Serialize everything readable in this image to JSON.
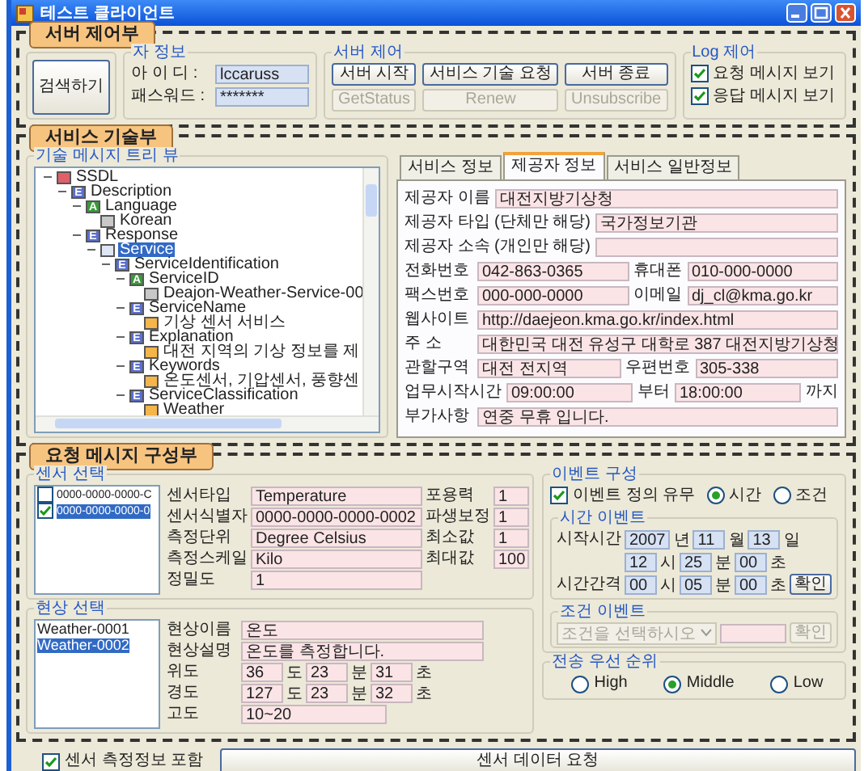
{
  "window": {
    "title": "테스트 클라이언트"
  },
  "server_control": {
    "badge": "서버 제어부",
    "search_button": "검색하기",
    "user_group": {
      "title": "자 정보",
      "fields": [
        {
          "label": "아 이 디 :",
          "value": "lccaruss"
        },
        {
          "label": "패스워드 :",
          "value": "*******"
        }
      ]
    },
    "server_group": {
      "title": "서버 제어",
      "buttons": [
        {
          "label": "서버 시작",
          "disabled": false
        },
        {
          "label": "서비스 기술 요청",
          "disabled": false
        },
        {
          "label": "서버 종료",
          "disabled": false
        },
        {
          "label": "GetStatus",
          "disabled": true
        },
        {
          "label": "Renew",
          "disabled": true
        },
        {
          "label": "Unsubscribe",
          "disabled": true
        }
      ]
    },
    "log_group": {
      "title": "Log 제어",
      "options": [
        {
          "label": "요청 메시지 보기",
          "checked": true
        },
        {
          "label": "응답 메시지 보기",
          "checked": true
        }
      ]
    }
  },
  "service_description": {
    "badge": "서비스 기술부",
    "tree": {
      "title": "기술 메시지 트리 뷰",
      "items": [
        {
          "label": "SSDL",
          "kind": "root",
          "selected": false,
          "expanded": true,
          "children": [
            {
              "label": "Description",
              "kind": "element",
              "tag": "E",
              "selected": false,
              "expanded": true,
              "children": [
                {
                  "label": "Language",
                  "kind": "attribute",
                  "tag": "A",
                  "selected": false,
                  "expanded": true,
                  "children": [
                    {
                      "label": "Korean",
                      "kind": "text",
                      "selected": false
                    }
                  ]
                },
                {
                  "label": "Response",
                  "kind": "element",
                  "tag": "E",
                  "selected": false,
                  "expanded": true,
                  "children": [
                    {
                      "label": "Service",
                      "kind": "pointer",
                      "selected": true,
                      "expanded": true,
                      "children": [
                        {
                          "label": "ServiceIdentification",
                          "kind": "element",
                          "tag": "E",
                          "selected": false,
                          "expanded": true,
                          "children": [
                            {
                              "label": "ServiceID",
                              "kind": "attribute",
                              "tag": "A",
                              "selected": false,
                              "expanded": true,
                              "children": [
                                {
                                  "label": "Deajon-Weather-Service-00",
                                  "kind": "text",
                                  "selected": false
                                }
                              ]
                            },
                            {
                              "label": "ServiceName",
                              "kind": "element",
                              "tag": "E",
                              "selected": false,
                              "expanded": true,
                              "children": [
                                {
                                  "label": "기상 센서 서비스",
                                  "kind": "value",
                                  "selected": false
                                }
                              ]
                            },
                            {
                              "label": "Explanation",
                              "kind": "element",
                              "tag": "E",
                              "selected": false,
                              "expanded": true,
                              "children": [
                                {
                                  "label": "대전 지역의 기상 정보를 제",
                                  "kind": "value",
                                  "selected": false
                                }
                              ]
                            },
                            {
                              "label": "Keywords",
                              "kind": "element",
                              "tag": "E",
                              "selected": false,
                              "expanded": true,
                              "children": [
                                {
                                  "label": "온도센서, 기압센서, 풍향센",
                                  "kind": "value",
                                  "selected": false
                                }
                              ]
                            },
                            {
                              "label": "ServiceClassification",
                              "kind": "element",
                              "tag": "E",
                              "selected": false,
                              "expanded": true,
                              "children": [
                                {
                                  "label": "Weather",
                                  "kind": "value",
                                  "selected": false
                                }
                              ]
                            }
                          ]
                        }
                      ]
                    }
                  ]
                }
              ]
            }
          ]
        }
      ]
    },
    "info": {
      "tabs": [
        {
          "label": "서비스 정보",
          "selected": false
        },
        {
          "label": "제공자 정보",
          "selected": true
        },
        {
          "label": "서비스 일반정보",
          "selected": false
        }
      ],
      "rows": [
        {
          "fields": [
            {
              "label": "제공자 이름",
              "value": "대전지방기상청"
            }
          ]
        },
        {
          "fields": [
            {
              "label": "제공자 타입 (단체만 해당)",
              "value": "국가정보기관"
            }
          ]
        },
        {
          "fields": [
            {
              "label": "제공자 소속 (개인만 해당)"
            }
          ]
        },
        {
          "fields": [
            {
              "label": "전화번호",
              "value": "042-863-0365"
            },
            {
              "label": "휴대폰",
              "value": "010-000-0000"
            }
          ]
        },
        {
          "fields": [
            {
              "label": "팩스번호",
              "value": "000-000-0000"
            },
            {
              "label": "이메일",
              "value": "dj_cl@kma.go.kr"
            }
          ]
        },
        {
          "fields": [
            {
              "label": "웹사이트",
              "value": "http://daejeon.kma.go.kr/index.html"
            }
          ]
        },
        {
          "fields": [
            {
              "label": "주 소",
              "value": "대한민국 대전 유성구 대학로 387 대전지방기상청"
            }
          ]
        },
        {
          "fields": [
            {
              "label": "관할구역",
              "value": "대전 전지역"
            },
            {
              "label": "우편번호",
              "value": "305-338"
            }
          ]
        },
        {
          "fields": [
            {
              "label": "업무시작시간",
              "value": "09:00:00"
            },
            {
              "label": "부터",
              "value": "18:00:00"
            }
          ],
          "suffix": "까지"
        },
        {
          "fields": [
            {
              "label": "부가사항",
              "value": "연중 무휴 입니다."
            }
          ]
        }
      ]
    }
  },
  "request": {
    "badge": "요청 메시지 구성부",
    "sensor_group": {
      "title": "센서 선택",
      "list": [
        {
          "label": "0000-0000-0000-C",
          "checked": false,
          "selected": false
        },
        {
          "label": "0000-0000-0000-0",
          "checked": true,
          "selected": true
        }
      ],
      "fields": [
        {
          "label": "센서타입",
          "value": "Temperature"
        },
        {
          "label": "포용력",
          "value": "1"
        },
        {
          "label": "센서식별자",
          "value": "0000-0000-0000-0002"
        },
        {
          "label": "파생보정",
          "value": "1"
        },
        {
          "label": "측정단위",
          "value": "Degree Celsius"
        },
        {
          "label": "최소값",
          "value": "1"
        },
        {
          "label": "측정스케일",
          "value": "Kilo"
        },
        {
          "label": "최대값",
          "value": "100"
        },
        {
          "label": "정밀도",
          "value": "1"
        }
      ]
    },
    "phenomenon_group": {
      "title": "현상 선택",
      "list": [
        {
          "label": "Weather-0001",
          "selected": false
        },
        {
          "label": "Weather-0002",
          "selected": true
        }
      ],
      "rows": [
        {
          "kind": "text",
          "label": "현상이름",
          "value": "온도"
        },
        {
          "kind": "text",
          "label": "현상설명",
          "value": "온도를 측정합니다."
        },
        {
          "kind": "parts",
          "label": "위도",
          "parts": [
            {
              "value": "36",
              "unit": "도"
            },
            {
              "value": "23",
              "unit": "분"
            },
            {
              "value": "31",
              "unit": "초"
            }
          ]
        },
        {
          "kind": "parts",
          "label": "경도",
          "parts": [
            {
              "value": "127",
              "unit": "도"
            },
            {
              "value": "23",
              "unit": "분"
            },
            {
              "value": "32",
              "unit": "초"
            }
          ]
        },
        {
          "kind": "short",
          "label": "고도",
          "value": "10~20"
        }
      ]
    },
    "event_group": {
      "title": "이벤트 구성",
      "define": {
        "label": "이벤트 정의 유무",
        "checked": true
      },
      "modes": [
        {
          "label": "시간",
          "selected": true
        },
        {
          "label": "조건",
          "selected": false
        }
      ],
      "time_event": {
        "title": "시간 이벤트",
        "rows": [
          {
            "label": "시작시간",
            "parts": [
              {
                "value": "2007",
                "unit": "년"
              },
              {
                "value": "11",
                "unit": "월"
              },
              {
                "value": "13",
                "unit": "일"
              }
            ]
          },
          {
            "parts": [
              {
                "value": "12",
                "unit": "시"
              },
              {
                "value": "25",
                "unit": "분"
              },
              {
                "value": "00",
                "unit": "초"
              }
            ]
          },
          {
            "label": "시간간격",
            "parts": [
              {
                "value": "00",
                "unit": "시"
              },
              {
                "value": "05",
                "unit": "분"
              },
              {
                "value": "00",
                "unit": "초"
              }
            ],
            "button": "확인"
          }
        ]
      },
      "condition_event": {
        "title": "조건 이벤트",
        "select": {
          "value": "조건을 선택하시오",
          "disabled": true
        },
        "button": {
          "label": "확인",
          "disabled": true
        }
      }
    },
    "priority_group": {
      "title": "전송 우선 순위",
      "options": [
        {
          "label": "High",
          "selected": false
        },
        {
          "label": "Middle",
          "selected": true
        },
        {
          "label": "Low",
          "selected": false
        }
      ]
    }
  },
  "footer": {
    "option": {
      "label": "센서 측정정보 포함",
      "checked": true
    },
    "button": "센서 데이터 요청"
  }
}
